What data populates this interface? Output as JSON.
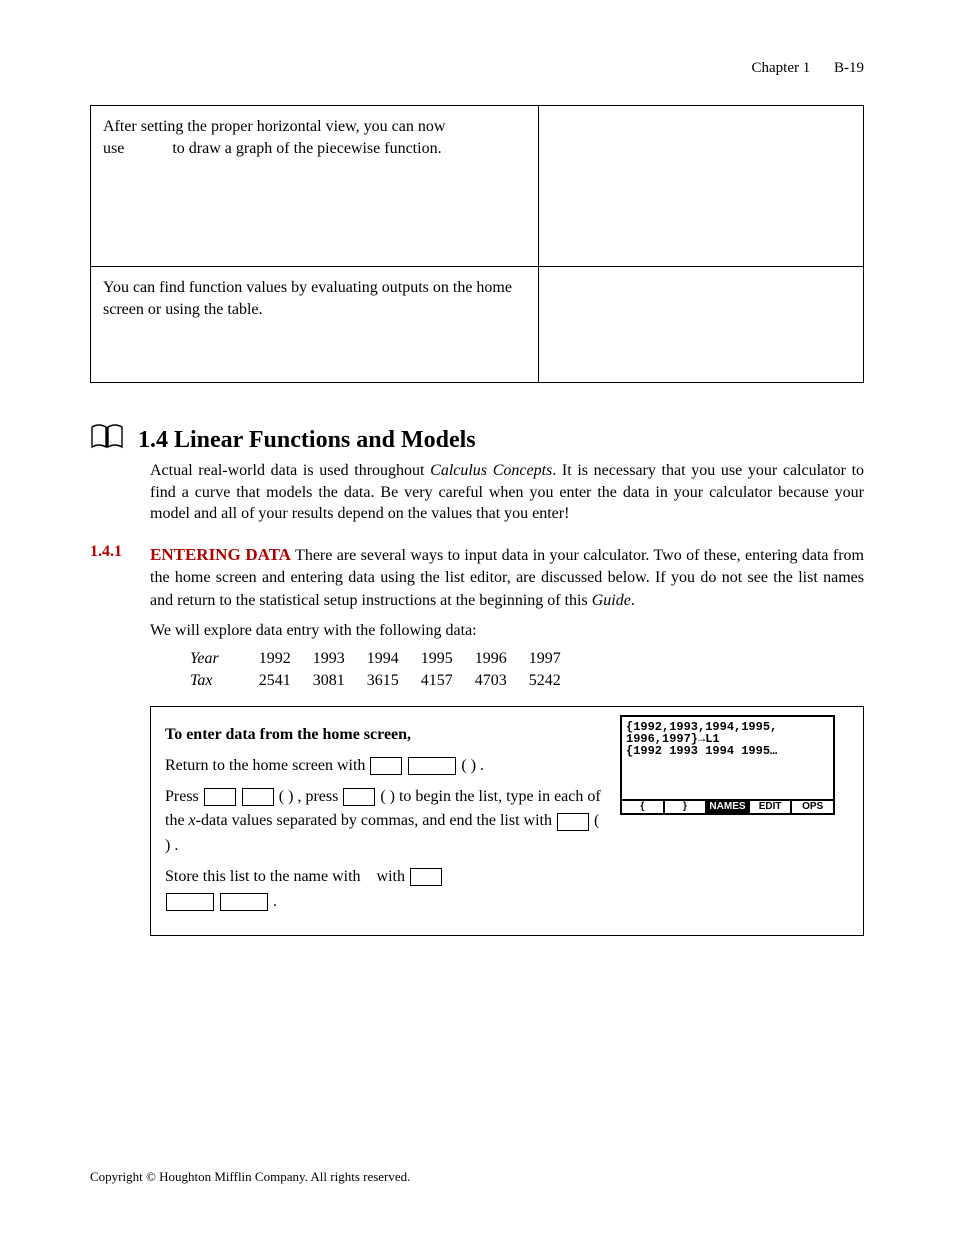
{
  "header": {
    "chapter": "Chapter 1",
    "page": "B-19"
  },
  "toptable": {
    "r1_left_a": "After setting the proper horizontal view, you can now",
    "r1_left_b": "use",
    "r1_left_c": "to draw a graph of the piecewise function.",
    "r2_left": "You can find function values by evaluating outputs on the home screen or using the table."
  },
  "section": {
    "number_title": "1.4  Linear Functions and Models",
    "intro_a": "Actual real-world data is used throughout ",
    "intro_ital": "Calculus Concepts",
    "intro_b": ".  It is necessary that you use your calculator to find a curve that models the data.  Be very careful when you enter the data in your calculator because your model and all of your results depend on the values that you enter!"
  },
  "subsection": {
    "num": "1.4.1",
    "runin": "ENTERING DATA",
    "body_a": "   There are several ways to input data in your calculator.  Two of these, entering data from the home screen and entering data using the list editor, are discussed below.  If you do not see the list names ",
    "body_mid": " and ",
    "body_b": " return to the statistical setup instructions at the beginning of this ",
    "body_guide": "Guide",
    "body_end": ".",
    "lead2": "We will explore data entry with the following data:"
  },
  "datatable": {
    "row1_label": "Year",
    "row1": [
      "1992",
      "1993",
      "1994",
      "1995",
      "1996",
      "1997"
    ],
    "row2_label": "Tax",
    "row2": [
      "2541",
      "3081",
      "3615",
      "4157",
      "4703",
      "5242"
    ]
  },
  "instr": {
    "heading": "To enter data from the home screen,",
    "p1_a": "Return to the home screen with ",
    "p1_b": " ( ",
    "p1_c": " ) .",
    "p2_a": "Press ",
    "p2_b": " ( ",
    "p2_c": " ) , press ",
    "p2_d": " ( ) to begin the list, type in each of the ",
    "p2_xital": "x",
    "p2_e": "-data values separated by commas, and end the list with ",
    "p2_f": " ( ) .",
    "p3_a": "Store this list to the name with ",
    "p3_b": " with ",
    "p3_c": " ."
  },
  "calc": {
    "l1": "{1992,1993,1994,1995,",
    "l2": "1996,1997}→L1",
    "l3": "{1992 1993 1994 1995…",
    "menu": [
      "{",
      "}",
      "NAMES",
      "EDIT",
      "OPS"
    ],
    "selected": 2
  },
  "footer": "Copyright © Houghton Mifflin Company.  All rights reserved.",
  "chart_data": {
    "type": "table",
    "title": "Year vs Tax data",
    "categories": [
      "1992",
      "1993",
      "1994",
      "1995",
      "1996",
      "1997"
    ],
    "series": [
      {
        "name": "Tax",
        "values": [
          2541,
          3081,
          3615,
          4157,
          4703,
          5242
        ]
      }
    ]
  }
}
